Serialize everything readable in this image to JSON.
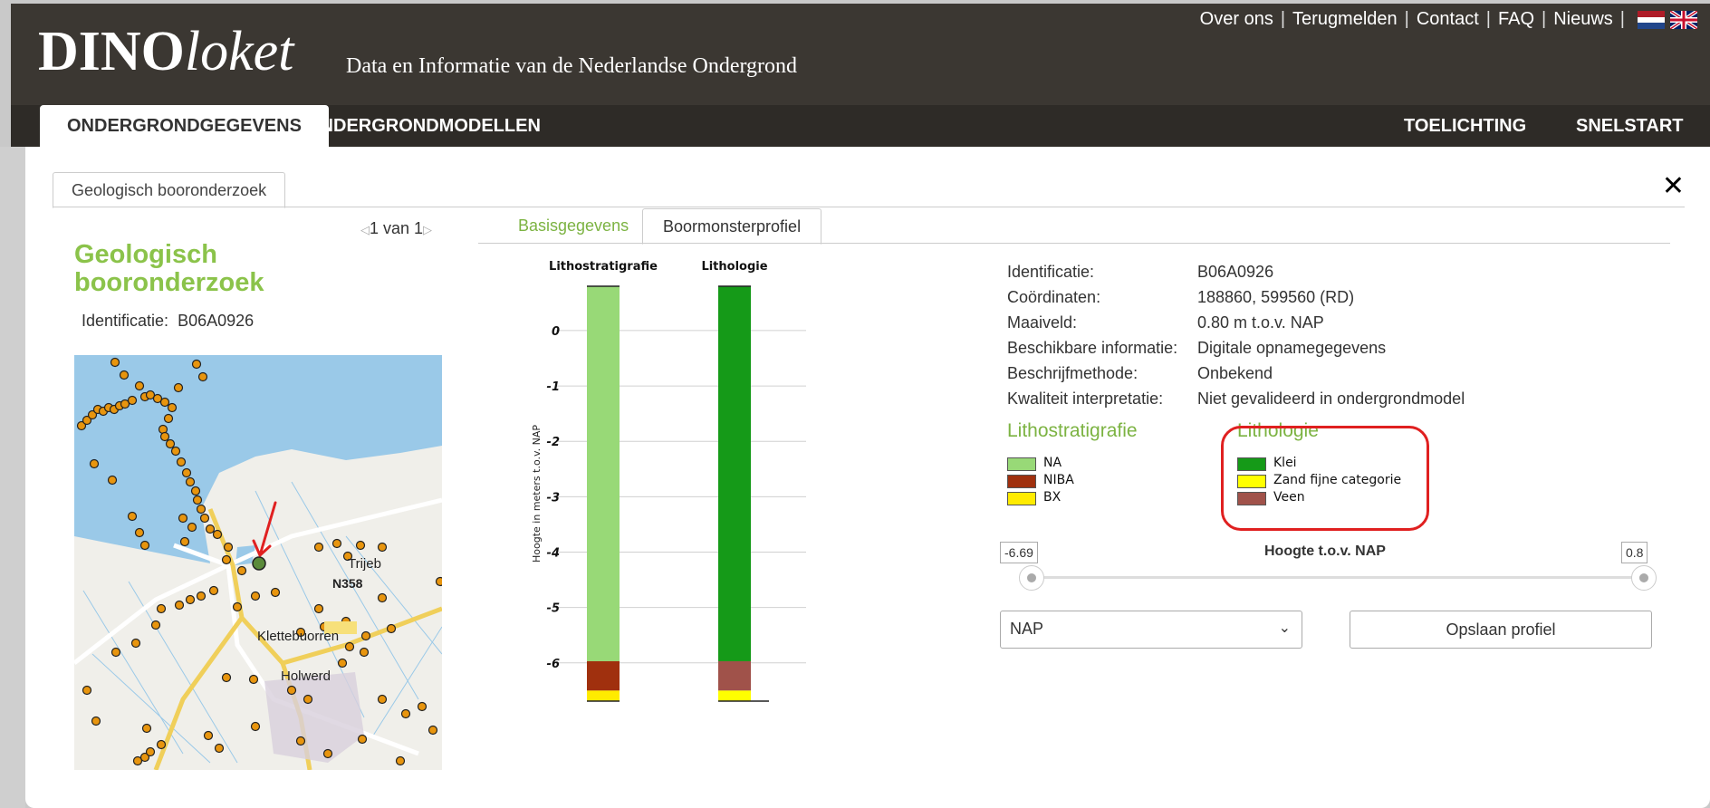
{
  "header": {
    "logo_bold": "DINO",
    "logo_italic": "loket",
    "tagline": "Data en Informatie van de Nederlandse Ondergrond",
    "links": [
      "Over ons",
      "Terugmelden",
      "Contact",
      "FAQ",
      "Nieuws"
    ]
  },
  "nav": {
    "tabs": [
      "ONDERGRONDGEGEVENS",
      "ONDERGRONDMODELLEN"
    ],
    "right_tabs": [
      "TOELICHTING",
      "SNELSTART"
    ]
  },
  "panel": {
    "tab_label": "Geologisch booronderzoek",
    "close": "✕",
    "pager": "1 van 1",
    "side_title": "Geologisch booronderzoek",
    "side_id_label": "Identificatie:",
    "side_id_value": "B06A0926"
  },
  "map": {
    "labels": [
      "Trijeb",
      "N358",
      "Klettebuorren",
      "Holwerd"
    ]
  },
  "inner_tabs": [
    "Basisgegevens",
    "Boormonsterprofiel"
  ],
  "info": [
    {
      "k": "Identificatie:",
      "v": "B06A0926"
    },
    {
      "k": "Coördinaten:",
      "v": "188860, 599560 (RD)"
    },
    {
      "k": "Maaiveld:",
      "v": "0.80 m t.o.v. NAP"
    },
    {
      "k": "Beschikbare informatie:",
      "v": "Digitale opnamegegevens"
    },
    {
      "k": "Beschrijfmethode:",
      "v": "Onbekend"
    },
    {
      "k": "Kwaliteit interpretatie:",
      "v": "Niet gevalideerd in ondergrondmodel"
    }
  ],
  "legend_litho": {
    "title": "Lithostratigrafie",
    "items": [
      {
        "label": "NA",
        "color": "#98d977"
      },
      {
        "label": "NIBA",
        "color": "#a0300e"
      },
      {
        "label": "BX",
        "color": "#ffeb00"
      }
    ]
  },
  "legend_lithologie": {
    "title": "Lithologie",
    "items": [
      {
        "label": "Klei",
        "color": "#159a18"
      },
      {
        "label": "Zand fijne categorie",
        "color": "#ffff00"
      },
      {
        "label": "Veen",
        "color": "#a0524a"
      }
    ]
  },
  "slider": {
    "min_value": "-6.69",
    "max_value": "0.8",
    "label": "Hoogte t.o.v. NAP"
  },
  "select_value": "NAP",
  "save_button": "Opslaan profiel",
  "chart_data": {
    "type": "bar",
    "columns": [
      "Lithostratigrafie",
      "Lithologie"
    ],
    "ylabel": "Hoogte in meters t.o.v. NAP",
    "yticks": [
      "0",
      "-1",
      "-2",
      "-3",
      "-4",
      "-5",
      "-6"
    ],
    "ylim": [
      -6.69,
      0.8
    ],
    "series": [
      {
        "name": "Lithostratigrafie",
        "layers": [
          {
            "unit": "NA",
            "top": 0.8,
            "bottom": -5.97,
            "color": "#98d977"
          },
          {
            "unit": "NIBA",
            "top": -5.97,
            "bottom": -6.5,
            "color": "#a0300e"
          },
          {
            "unit": "BX",
            "top": -6.5,
            "bottom": -6.69,
            "color": "#ffeb00"
          }
        ]
      },
      {
        "name": "Lithologie",
        "layers": [
          {
            "unit": "Klei",
            "top": 0.8,
            "bottom": -5.97,
            "color": "#159a18"
          },
          {
            "unit": "Veen",
            "top": -5.97,
            "bottom": -6.5,
            "color": "#a0524a"
          },
          {
            "unit": "Zand fijne categorie",
            "top": -6.5,
            "bottom": -6.69,
            "color": "#ffff00"
          }
        ]
      }
    ]
  }
}
